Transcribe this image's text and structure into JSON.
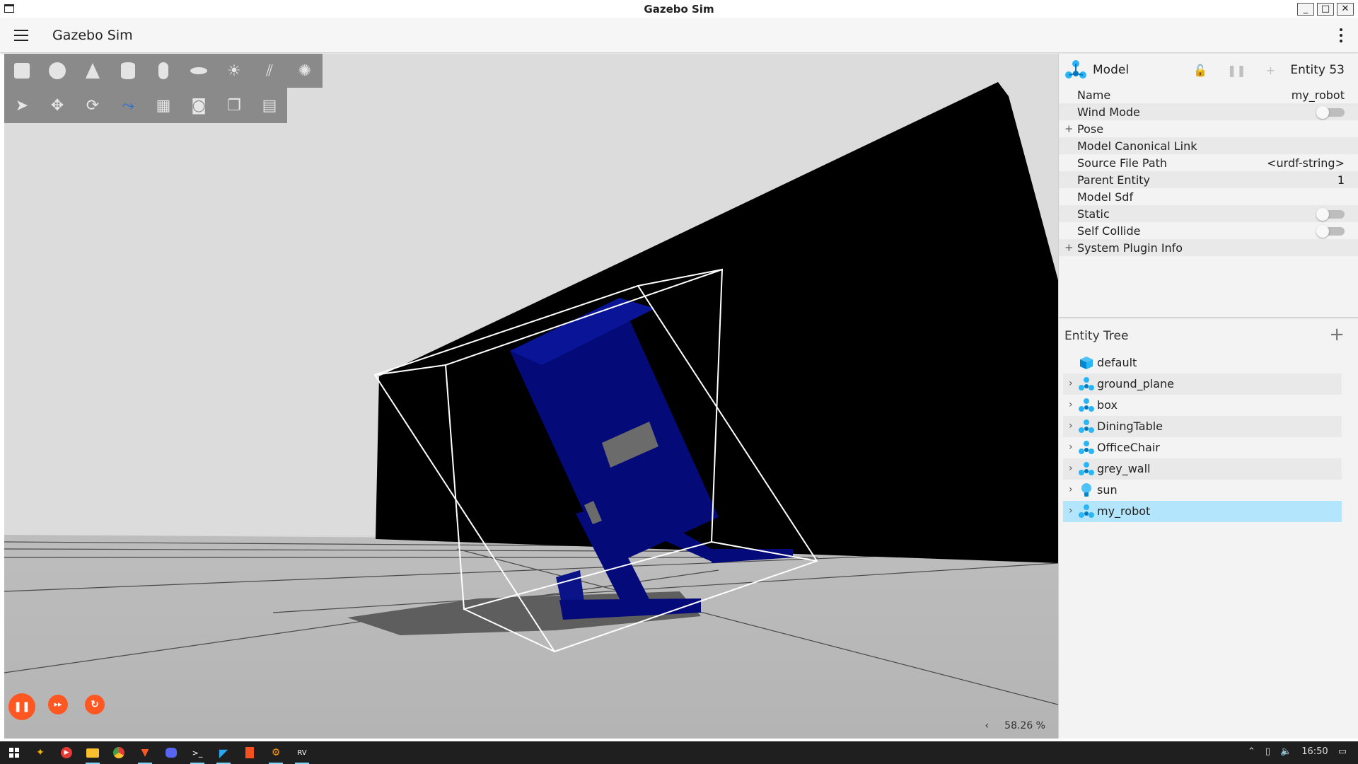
{
  "window": {
    "title": "Gazebo Sim",
    "buttons": [
      "_",
      "□",
      "✕"
    ]
  },
  "app": {
    "title": "Gazebo Sim"
  },
  "toolbar_shapes": [
    "box",
    "sphere",
    "cone",
    "cylinder",
    "capsule",
    "ellipsoid",
    "sun",
    "directional-light",
    "spot-light"
  ],
  "toolbar_tools": [
    "select",
    "translate",
    "rotate",
    "transform-control",
    "grid",
    "screenshot",
    "copy",
    "paste"
  ],
  "playback": {
    "pause": "❚❚",
    "step": "▸▸",
    "reset": "↻"
  },
  "view": {
    "zoom_label": "58.26 %",
    "collapse_arrow": "‹"
  },
  "component": {
    "title": "Model",
    "entity_label": "Entity 53",
    "properties": [
      {
        "label": "Name",
        "value": "my_robot",
        "type": "text"
      },
      {
        "label": "Wind Mode",
        "type": "toggle",
        "on": false
      },
      {
        "label": "Pose",
        "type": "expandable"
      },
      {
        "label": "Model Canonical Link",
        "type": "text",
        "value": ""
      },
      {
        "label": "Source File Path",
        "value": "<urdf-string>",
        "type": "text"
      },
      {
        "label": "Parent Entity",
        "value": "1",
        "type": "text"
      },
      {
        "label": "Model Sdf",
        "type": "text",
        "value": ""
      },
      {
        "label": "Static",
        "type": "toggle",
        "on": false
      },
      {
        "label": "Self Collide",
        "type": "toggle",
        "on": false
      },
      {
        "label": "System Plugin Info",
        "type": "expandable"
      }
    ]
  },
  "entity_tree": {
    "title": "Entity Tree",
    "add_label": "+",
    "items": [
      {
        "label": "default",
        "icon": "world-cube-icon",
        "expandable": false
      },
      {
        "label": "ground_plane",
        "icon": "model-icon",
        "expandable": true
      },
      {
        "label": "box",
        "icon": "model-icon",
        "expandable": true
      },
      {
        "label": "DiningTable",
        "icon": "model-icon",
        "expandable": true
      },
      {
        "label": "OfficeChair",
        "icon": "model-icon",
        "expandable": true
      },
      {
        "label": "grey_wall",
        "icon": "model-icon",
        "expandable": true
      },
      {
        "label": "sun",
        "icon": "light-bulb-icon",
        "expandable": true
      },
      {
        "label": "my_robot",
        "icon": "model-icon",
        "expandable": true,
        "selected": true
      }
    ]
  },
  "taskbar": {
    "time": "16:50",
    "icons": [
      "start",
      "copilot",
      "youtube-music",
      "file-explorer",
      "chrome",
      "brave",
      "discord",
      "terminal",
      "vscode",
      "document-viewer",
      "gazebo",
      "rviz"
    ]
  },
  "colors": {
    "accent": "#ff5722",
    "selection": "#b3e5fc",
    "robot": "#050a7a",
    "toolbar": "#8a8a8a"
  }
}
